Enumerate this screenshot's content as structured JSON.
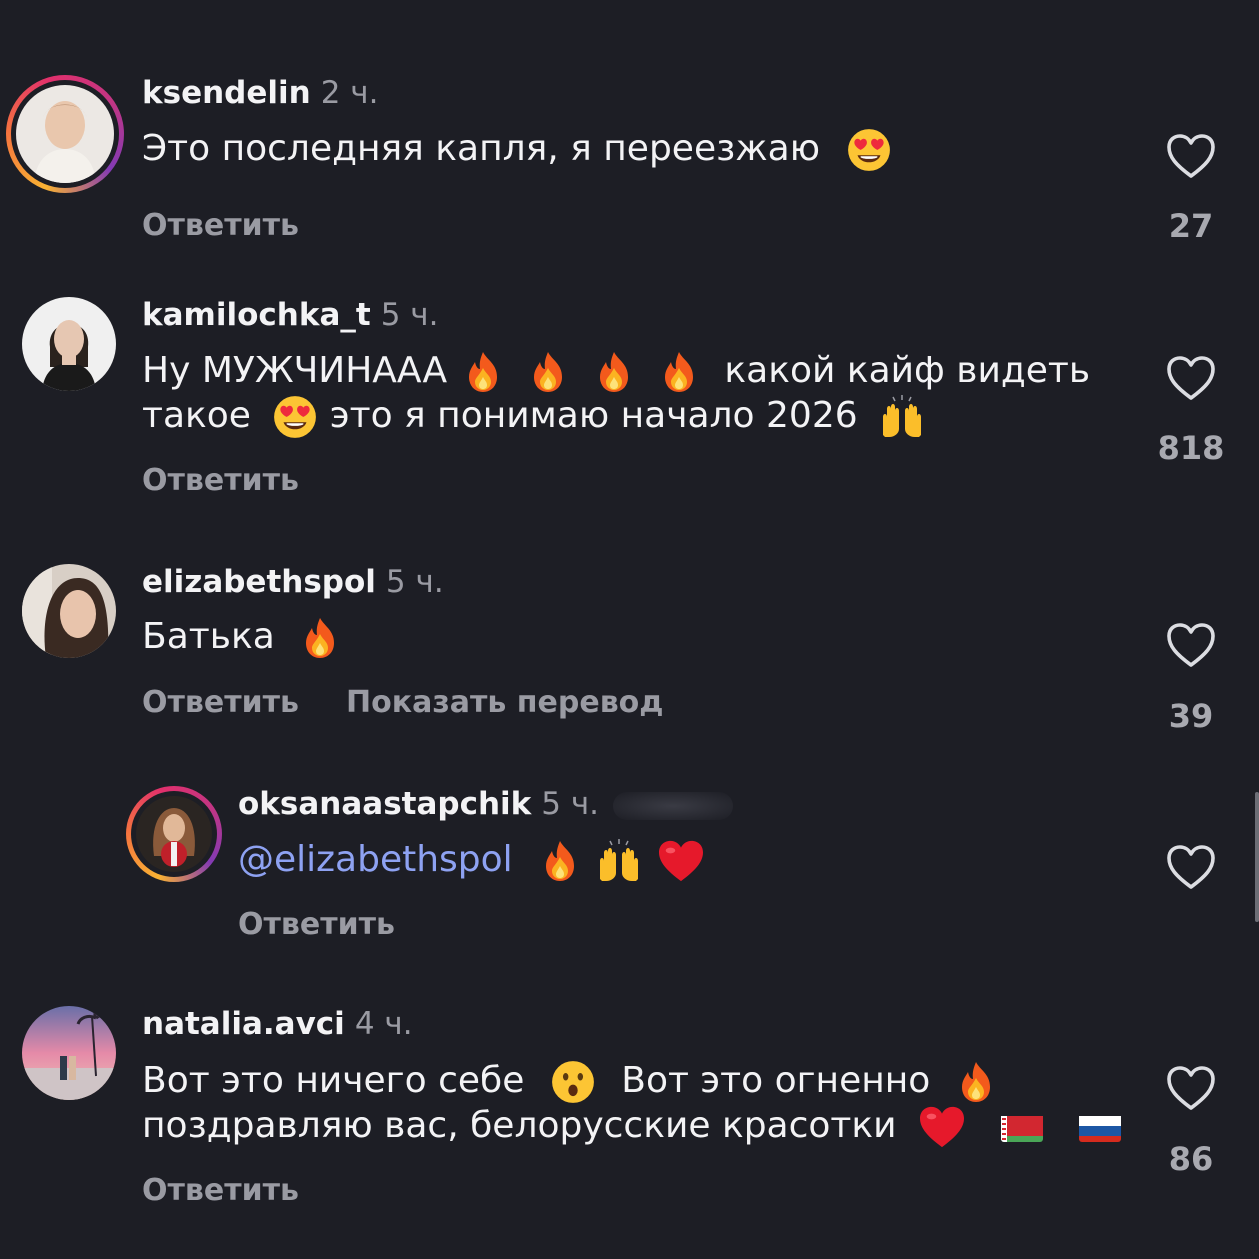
{
  "comments": [
    {
      "username": "ksendelin",
      "time": "2 ч.",
      "text": "Это последняя капля, я переезжаю",
      "reply": "Ответить",
      "likes": "27"
    },
    {
      "username": "kamilochka_t",
      "time": "5 ч.",
      "text_line1_a": "Ну МУЖЧИНАAA",
      "text_line1_b": "какой кайф видеть",
      "text_line2_a": "такое",
      "text_line2_b": "это я понимаю начало 2026",
      "reply": "Ответить",
      "likes": "818"
    },
    {
      "username": "elizabethspol",
      "time": "5 ч.",
      "text": "Батька",
      "reply": "Ответить",
      "translate": "Показать перевод",
      "likes": "39"
    },
    {
      "username": "oksanaastapchik",
      "time": "5 ч.",
      "mention": "@elizabethspol",
      "reply": "Ответить"
    },
    {
      "username": "natalia.avci",
      "time": "4 ч.",
      "text_line1_a": "Вот это ничего себе",
      "text_line1_b": "Вот это огненно",
      "text_line2": "поздравляю вас, белорусские красотки",
      "reply": "Ответить",
      "likes": "86"
    }
  ],
  "icons": {
    "heart": "heart-outline-icon",
    "fire": "fire-emoji",
    "heart_eyes": "heart-eyes-emoji",
    "raised_hands": "raised-hands-emoji",
    "red_heart": "red-heart-emoji",
    "hushed": "hushed-face-emoji",
    "flag_by": "belarus-flag",
    "flag_ru": "russia-flag"
  },
  "colors": {
    "background": "#1d1e25",
    "text": "#f3f3f5",
    "muted": "#9a9ba3",
    "mention": "#8ea2f2"
  }
}
